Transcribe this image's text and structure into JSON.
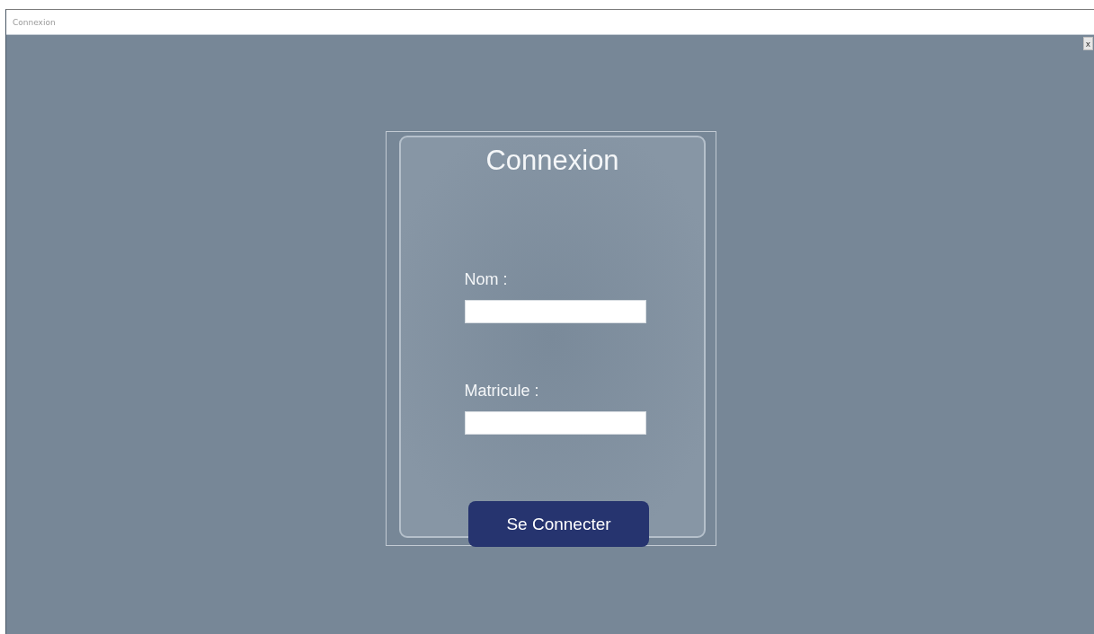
{
  "window": {
    "title": "Connexion",
    "close": "x"
  },
  "form": {
    "title": "Connexion",
    "fields": [
      {
        "label": "Nom :"
      },
      {
        "label": "Matricule :"
      }
    ],
    "button": "Se Connecter"
  }
}
